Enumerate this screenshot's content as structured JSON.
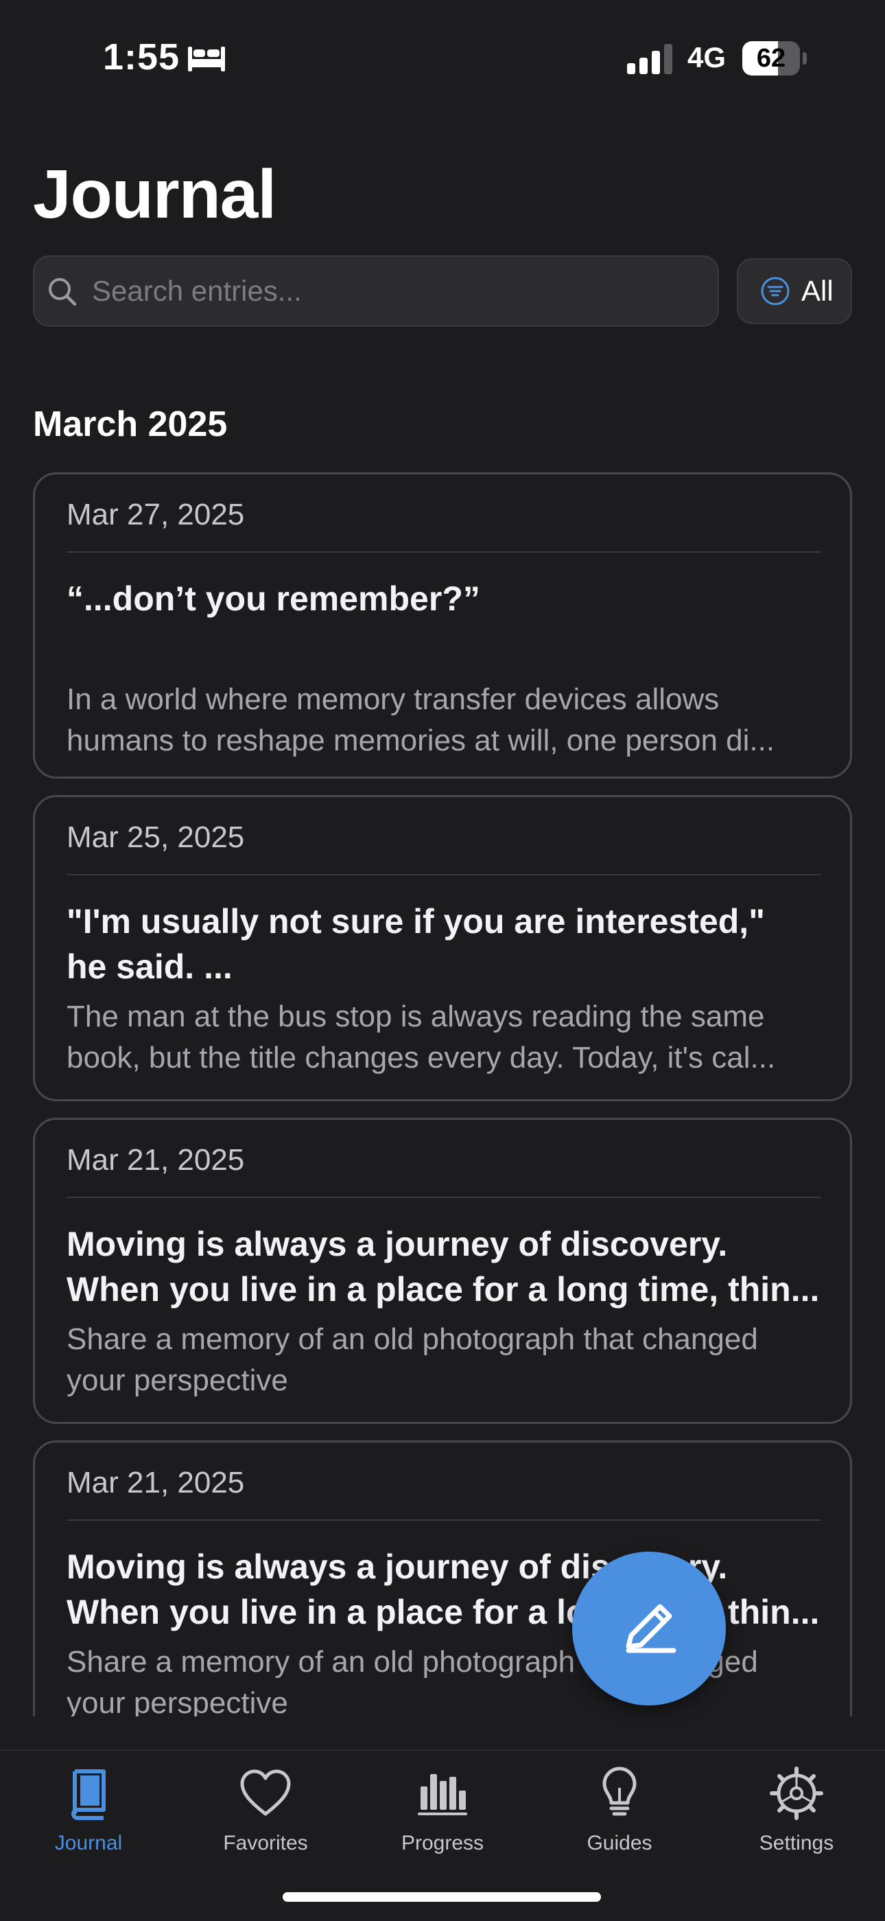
{
  "status_bar": {
    "time": "1:55",
    "network": "4G",
    "battery_level": "62",
    "battery_fraction": 0.62
  },
  "header": {
    "title": "Journal",
    "search_placeholder": "Search entries...",
    "filter_label": "All"
  },
  "section": {
    "title": "March 2025"
  },
  "entries": [
    {
      "date": "Mar 27, 2025",
      "title": "“...don’t you remember?”",
      "body": "In a world where memory transfer devices allows\nhumans to reshape memories at will, one person di..."
    },
    {
      "date": "Mar 25, 2025",
      "title": "\"I'm usually not sure if you are interested,\"\nhe said. ...",
      "body": "The man at the bus stop is always reading the same\nbook, but the title changes every day. Today, it's cal..."
    },
    {
      "date": "Mar 21, 2025",
      "title": "Moving is always a journey of discovery.\nWhen you live in a place for a long time, thin...",
      "body": "Share a memory of an old photograph that changed\nyour perspective"
    },
    {
      "date": "Mar 21, 2025",
      "title": "Moving is always a journey of discovery.\nWhen you live in a place for a long time, thin...",
      "body": "Share a memory of an old photograph that changed\nyour perspective"
    }
  ],
  "tabs": [
    {
      "label": "Journal",
      "icon": "book-icon",
      "active": true
    },
    {
      "label": "Favorites",
      "icon": "heart-icon",
      "active": false
    },
    {
      "label": "Progress",
      "icon": "bar-chart-icon",
      "active": false
    },
    {
      "label": "Guides",
      "icon": "lightbulb-icon",
      "active": false
    },
    {
      "label": "Settings",
      "icon": "gear-icon",
      "active": false
    }
  ],
  "colors": {
    "background": "#1c1c1e",
    "accent": "#4a8fe0",
    "card_border": "#48484a",
    "muted_text": "#a6a6ab"
  }
}
